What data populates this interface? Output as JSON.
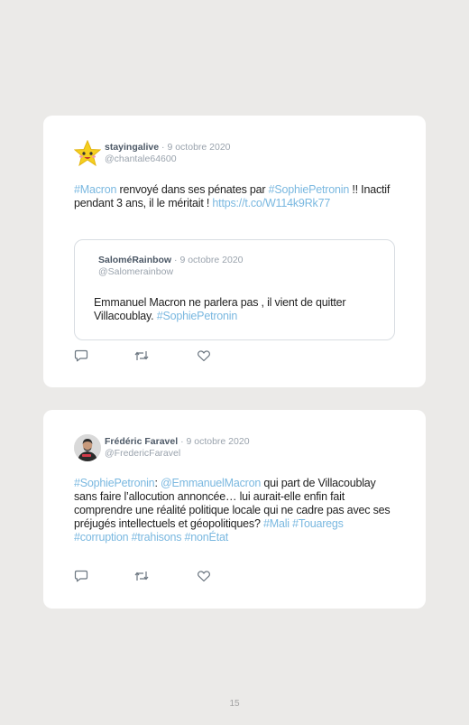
{
  "tweets": [
    {
      "author": "stayingalive",
      "date": "· 9 octobre 2020",
      "handle": "@chantale64600",
      "text_parts": [
        "#Macron",
        " renvoyé dans ses pénates par ",
        "#SophiePetronin",
        " !! Inactif pendant 3 ans, il le méritait ! ",
        "https://t.co/W114k9Rk77"
      ],
      "avatar_icon": "star-smiley-icon",
      "quoted": {
        "author": "SaloméRainbow",
        "date": "· 9 octobre 2020",
        "handle": "@Salomerainbow",
        "text_parts": [
          "Emmanuel Macron ne parlera pas , il vient de quitter Villacoublay. ",
          "#SophiePetronin"
        ]
      }
    },
    {
      "author": "Frédéric Faravel",
      "date": "· 9 octobre 2020",
      "handle": "@FredericFaravel",
      "text_parts": [
        "#SophiePetronin",
        ": ",
        "@EmmanuelMacron",
        " qui part de Villacoublay sans faire l’allocution annoncée… lui aurait-elle enfin fait comprendre une réalité politique locale qui ne cadre pas avec ses préjugés intellectuels et géopolitiques? ",
        "#Mali #Touaregs #corruption #trahisons #nonÉtat"
      ],
      "avatar_icon": "person-photo-icon"
    }
  ],
  "actions": [
    "reply-icon",
    "retweet-icon",
    "like-icon"
  ],
  "page_number": "15",
  "colors": {
    "background": "#ebeae8",
    "card": "#ffffff",
    "link": "#7ab8e0",
    "text": "#222222",
    "muted": "#9aa3ad"
  }
}
